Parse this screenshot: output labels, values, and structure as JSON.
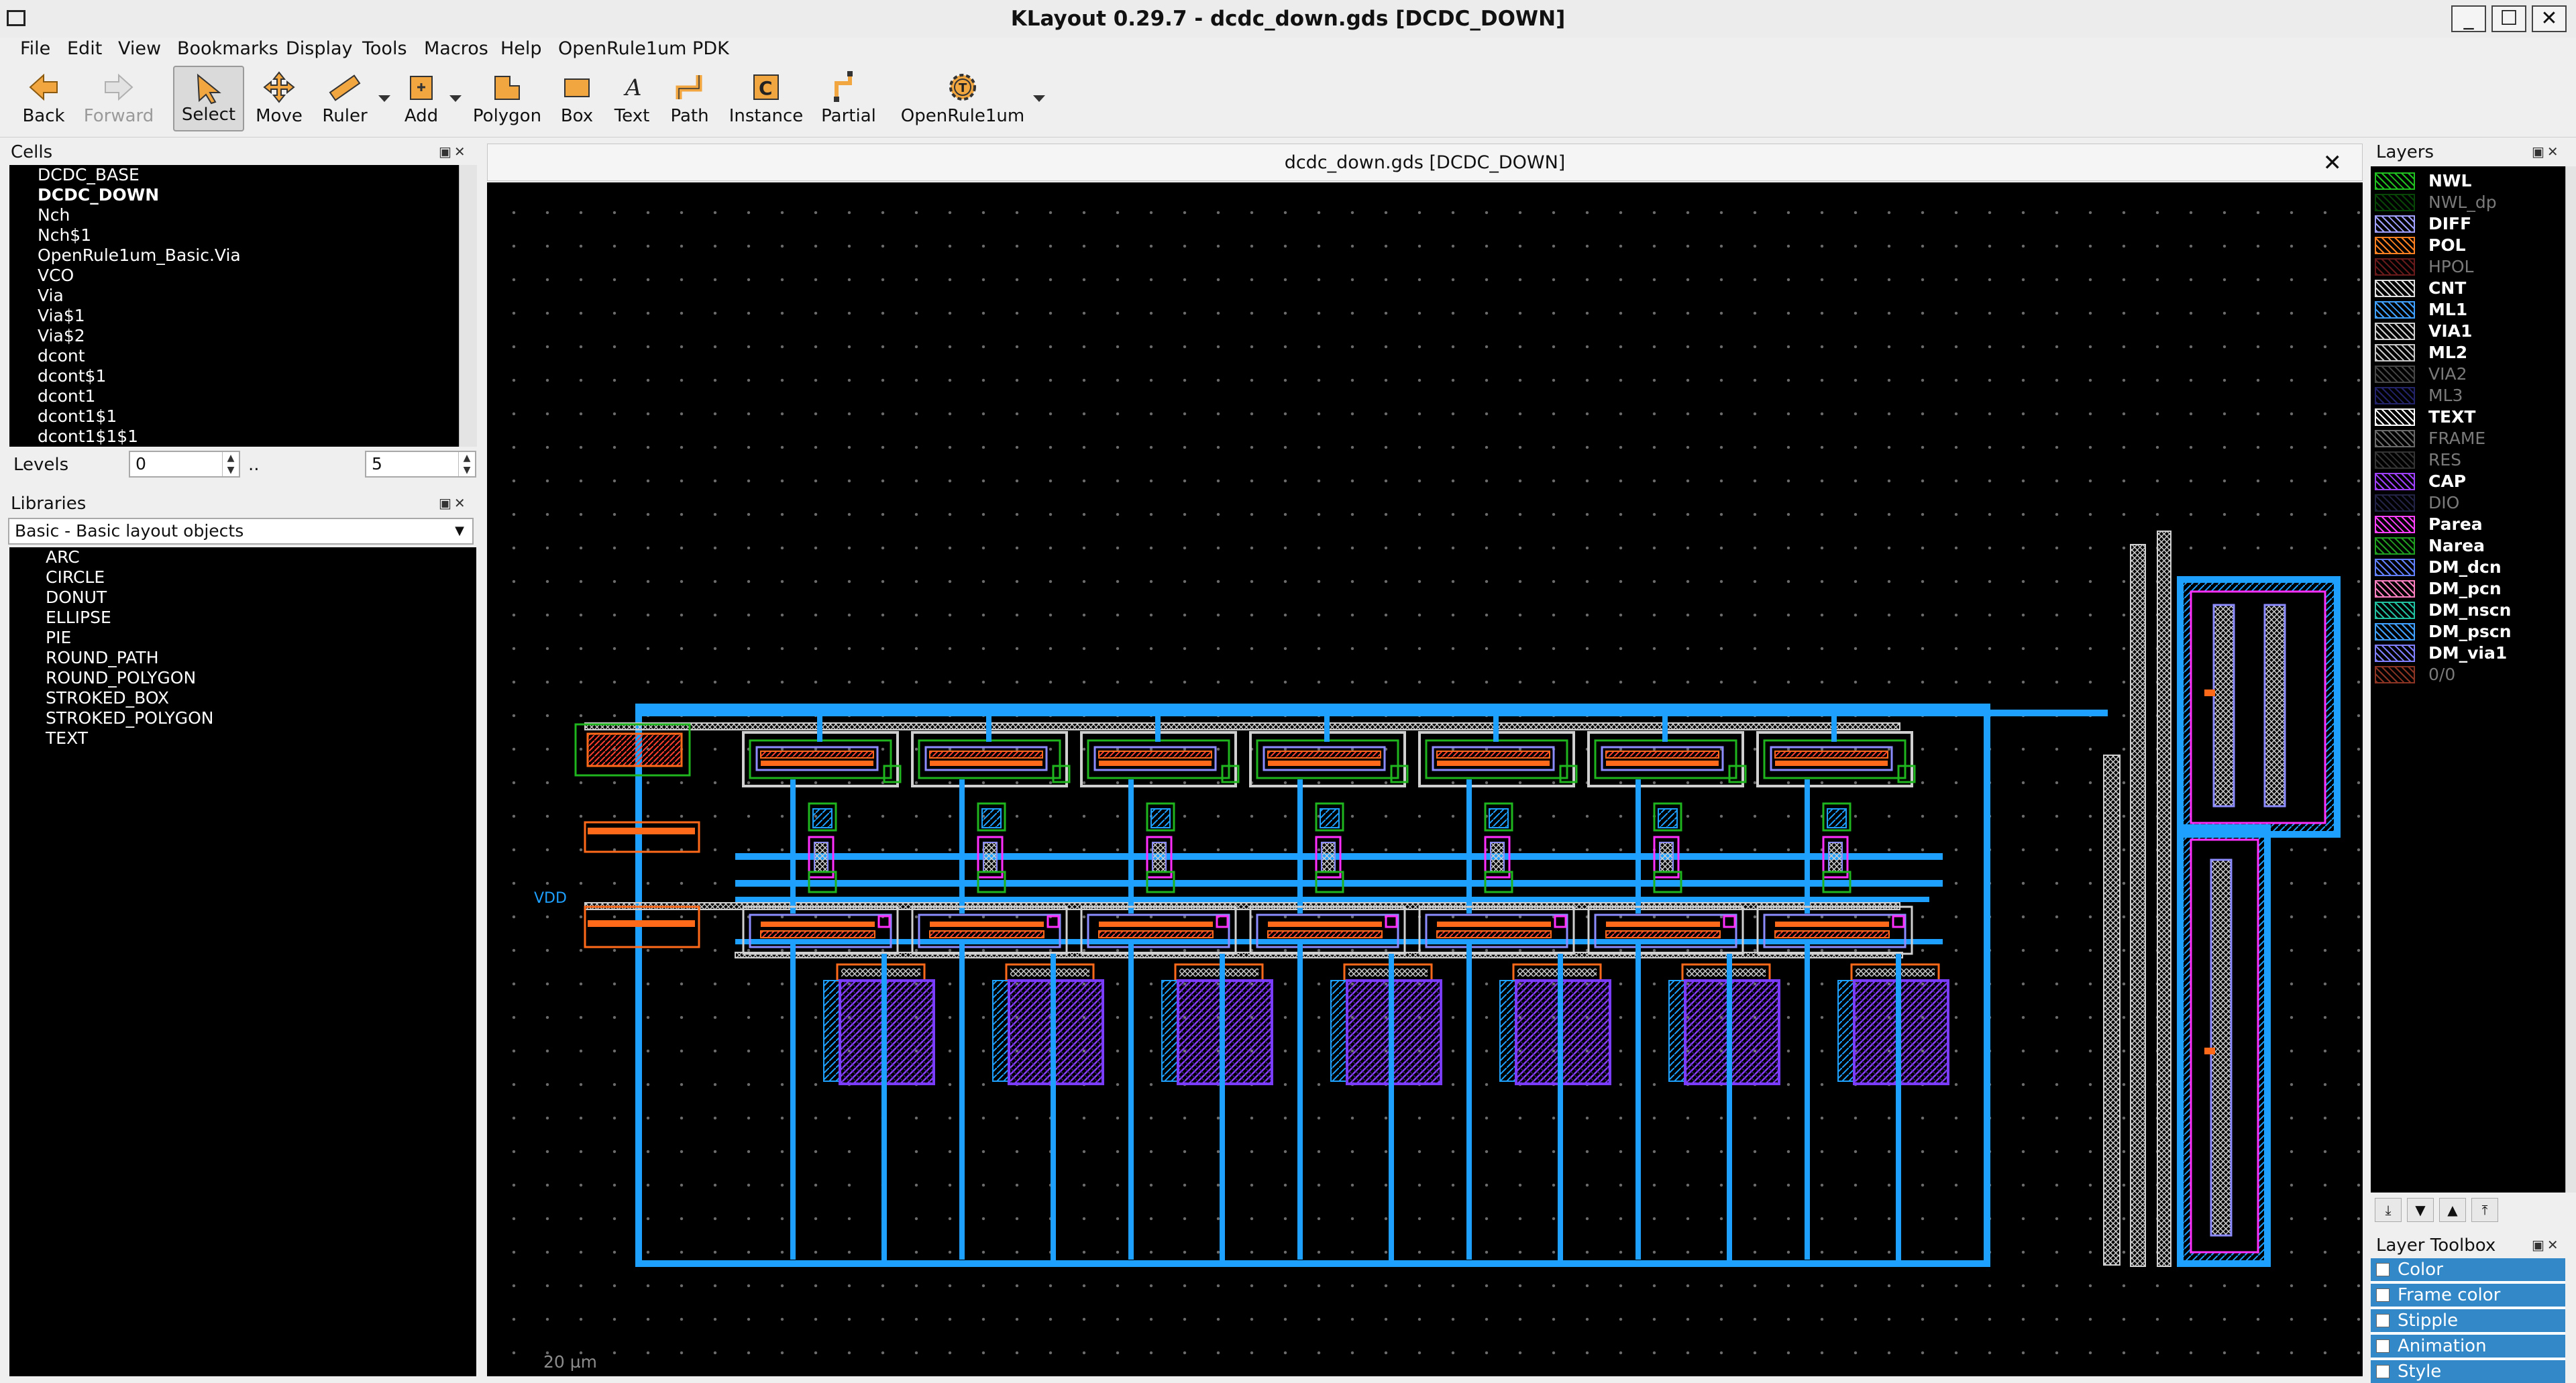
{
  "window": {
    "title": "KLayout 0.29.7 - dcdc_down.gds [DCDC_DOWN]",
    "minimize": "_",
    "maximize": "☐",
    "close": "✕"
  },
  "menu": [
    "File",
    "Edit",
    "View",
    "Bookmarks",
    "Display",
    "Tools",
    "Macros",
    "Help",
    "OpenRule1um PDK"
  ],
  "toolbar": {
    "back": "Back",
    "forward": "Forward",
    "select": "Select",
    "move": "Move",
    "ruler": "Ruler",
    "add": "Add",
    "polygon": "Polygon",
    "box": "Box",
    "text": "Text",
    "path": "Path",
    "instance": "Instance",
    "partial": "Partial",
    "openrule": "OpenRule1um"
  },
  "cells_panel": {
    "title": "Cells",
    "items": [
      "DCDC_BASE",
      "DCDC_DOWN",
      "Nch",
      "Nch$1",
      "OpenRule1um_Basic.Via",
      "VCO",
      "Via",
      "Via$1",
      "Via$2",
      "dcont",
      "dcont$1",
      "dcont1",
      "dcont1$1",
      "dcont1$1$1"
    ],
    "selected": "DCDC_DOWN",
    "levels_label": "Levels",
    "levels_from": "0",
    "levels_sep": "..",
    "levels_to": "5"
  },
  "libraries_panel": {
    "title": "Libraries",
    "selected_library": "Basic - Basic layout objects",
    "items": [
      "ARC",
      "CIRCLE",
      "DONUT",
      "ELLIPSE",
      "PIE",
      "ROUND_PATH",
      "ROUND_POLYGON",
      "STROKED_BOX",
      "STROKED_POLYGON",
      "TEXT"
    ]
  },
  "view": {
    "tab_title": "dcdc_down.gds [DCDC_DOWN]",
    "tab_close": "✕",
    "scale": "20 µm",
    "background": "#000000"
  },
  "layers_panel": {
    "title": "Layers",
    "layers": [
      {
        "name": "NWL",
        "color": "#20c020",
        "visible": true
      },
      {
        "name": "NWL_dp",
        "color": "#108010",
        "visible": false
      },
      {
        "name": "DIFF",
        "color": "#a0a0ff",
        "visible": true
      },
      {
        "name": "POL",
        "color": "#ff8020",
        "visible": true
      },
      {
        "name": "HPOL",
        "color": "#c03030",
        "visible": false
      },
      {
        "name": "CNT",
        "color": "#e0e0e0",
        "visible": true
      },
      {
        "name": "ML1",
        "color": "#40a0ff",
        "visible": true
      },
      {
        "name": "VIA1",
        "color": "#d0d0d0",
        "visible": true
      },
      {
        "name": "ML2",
        "color": "#c8c8c8",
        "visible": true
      },
      {
        "name": "VIA2",
        "color": "#808080",
        "visible": false
      },
      {
        "name": "ML3",
        "color": "#4040c0",
        "visible": false
      },
      {
        "name": "TEXT",
        "color": "#ffffff",
        "visible": true
      },
      {
        "name": "FRAME",
        "color": "#c0c0c0",
        "visible": false
      },
      {
        "name": "RES",
        "color": "#606060",
        "visible": false
      },
      {
        "name": "CAP",
        "color": "#a040ff",
        "visible": true
      },
      {
        "name": "DIO",
        "color": "#404080",
        "visible": false
      },
      {
        "name": "Parea",
        "color": "#ff40ff",
        "visible": true
      },
      {
        "name": "Narea",
        "color": "#20a020",
        "visible": true
      },
      {
        "name": "DM_dcn",
        "color": "#6080ff",
        "visible": true
      },
      {
        "name": "DM_pcn",
        "color": "#ff80c0",
        "visible": true
      },
      {
        "name": "DM_nscn",
        "color": "#20c0a0",
        "visible": true
      },
      {
        "name": "DM_pscn",
        "color": "#40a0ff",
        "visible": true
      },
      {
        "name": "DM_via1",
        "color": "#8080ff",
        "visible": true
      },
      {
        "name": "0/0",
        "color": "#ff6040",
        "visible": false
      }
    ]
  },
  "layer_toolbox": {
    "title": "Layer Toolbox",
    "items": [
      "Color",
      "Frame color",
      "Stipple",
      "Animation",
      "Style"
    ]
  },
  "colors": {
    "metal1": "#1ea0ff",
    "poly": "#ff6a1a",
    "cap": "#7a3cff",
    "nwell": "#1fb51f",
    "diff": "#8c8cff",
    "parea": "#ff30ff",
    "ml2": "#d0d0d0"
  }
}
